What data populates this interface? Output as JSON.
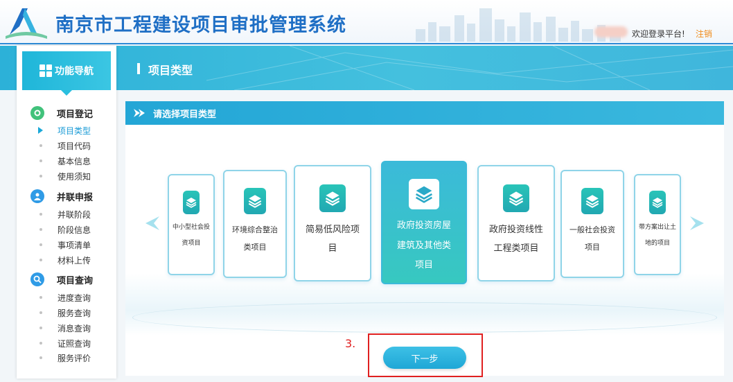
{
  "header": {
    "title": "南京市工程建设项目审批管理系统",
    "welcome": "欢迎登录平台!",
    "logout": "注销"
  },
  "banner": {
    "title": "项目类型"
  },
  "sidebar": {
    "nav_title": "功能导航",
    "sections": [
      {
        "label": "项目登记",
        "icon": "gear-icon",
        "color": "#41c27b",
        "items": [
          "项目类型",
          "项目代码",
          "基本信息",
          "使用须知"
        ],
        "active": 0
      },
      {
        "label": "并联申报",
        "icon": "user-icon",
        "color": "#2f9be6",
        "items": [
          "并联阶段",
          "阶段信息",
          "事项清单",
          "材料上传"
        ]
      },
      {
        "label": "项目查询",
        "icon": "search-icon",
        "color": "#2f9be6",
        "items": [
          "进度查询",
          "服务查询",
          "消息查询",
          "证照查询",
          "服务评价"
        ]
      }
    ]
  },
  "panel": {
    "title": "请选择项目类型",
    "cards": [
      {
        "label_lines": [
          "中小型社会投",
          "资项目"
        ],
        "icon": "layers-icon"
      },
      {
        "label_lines": [
          "环境综合整治",
          "类项目"
        ],
        "icon": "layers-icon"
      },
      {
        "label_lines": [
          "简易低风险项",
          "目"
        ],
        "icon": "layers-icon"
      },
      {
        "label_lines": [
          "政府投资房屋",
          "建筑及其他类",
          "项目"
        ],
        "icon": "layers-icon",
        "selected": true
      },
      {
        "label_lines": [
          "政府投资线性",
          "工程类项目"
        ],
        "icon": "layers-icon"
      },
      {
        "label_lines": [
          "一般社会投资",
          "项目"
        ],
        "icon": "layers-icon"
      },
      {
        "label_lines": [
          "带方案出让土",
          "地的项目"
        ],
        "icon": "layers-icon"
      }
    ],
    "prev_icon": "chevron-left-icon",
    "next_icon": "chevron-right-icon"
  },
  "footer": {
    "next_button": "下一步"
  },
  "annotation": {
    "step": "3."
  },
  "colors": {
    "accent": "#23a6d6",
    "selected_card": "#3bbad9",
    "highlight": "#e02020",
    "logout": "#f08c1a"
  }
}
